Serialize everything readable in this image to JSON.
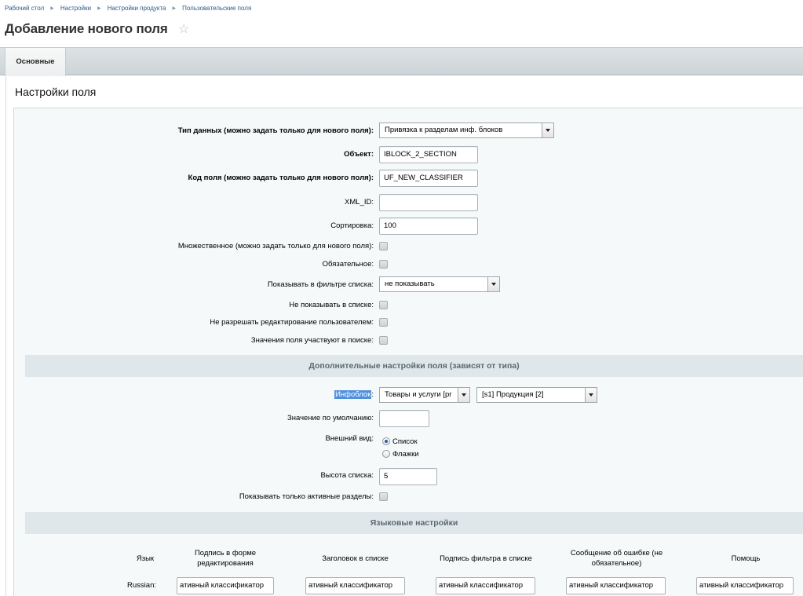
{
  "breadcrumb": [
    "Рабочий стол",
    "Настройки",
    "Настройки продукта",
    "Пользовательские поля"
  ],
  "page_title": "Добавление нового поля",
  "tabs": [
    {
      "label": "Основные"
    }
  ],
  "section_title": "Настройки поля",
  "form": {
    "data_type_label": "Тип данных (можно задать только для нового поля):",
    "data_type_value": "Привязка к разделам инф. блоков",
    "object_label": "Объект:",
    "object_value": "IBLOCK_2_SECTION",
    "field_code_label": "Код поля (можно задать только для нового поля):",
    "field_code_value": "UF_NEW_CLASSIFIER",
    "xml_id_label": "XML_ID:",
    "xml_id_value": "",
    "sort_label": "Сортировка:",
    "sort_value": "100",
    "multiple_label": "Множественное (можно задать только для нового поля):",
    "required_label": "Обязательное:",
    "filter_label": "Показывать в фильтре списка:",
    "filter_value": "не показывать",
    "hide_in_list_label": "Не показывать в списке:",
    "no_edit_label": "Не разрешать редактирование пользователем:",
    "search_label": "Значения поля участвуют в поиске:"
  },
  "extra": {
    "header": "Дополнительные настройки поля (зависят от типа)",
    "iblock_label": "Инфоблок",
    "iblock_colon": ":",
    "iblock_type_value": "Товары и услуги [pr",
    "iblock_value": "[s1] Продукция [2]",
    "default_label": "Значение по умолчанию:",
    "default_value": "",
    "view_label": "Внешний вид:",
    "view_options": [
      "Список",
      "Флажки"
    ],
    "view_selected": "Список",
    "height_label": "Высота списка:",
    "height_value": "5",
    "active_only_label": "Показывать только активные разделы:"
  },
  "lang": {
    "header": "Языковые настройки",
    "columns": [
      "Язык",
      "Подпись в форме редактирования",
      "Заголовок в списке",
      "Подпись фильтра в списке",
      "Сообщение об ошибке (не обязательное)",
      "Помощь"
    ],
    "rows": [
      {
        "lang": "Russian:",
        "values": [
          "ативный классификатор",
          "ативный классификатор",
          "ативный классификатор",
          "ативный классификатор",
          "ативный классификатор"
        ]
      }
    ]
  }
}
